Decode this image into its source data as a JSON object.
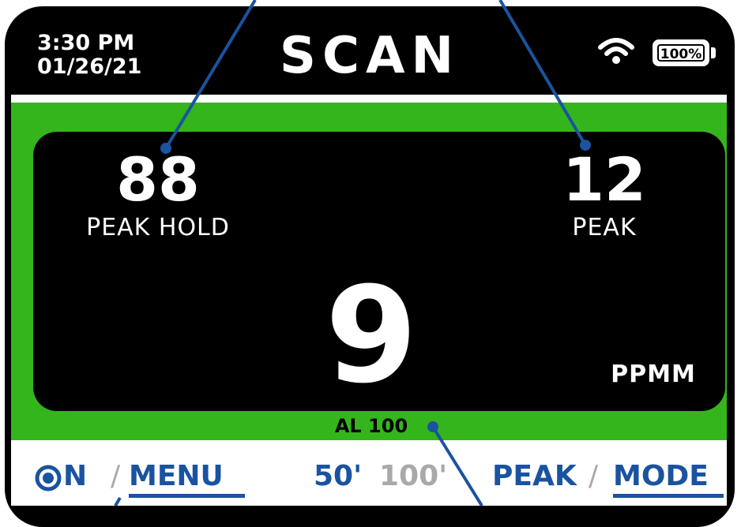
{
  "status": {
    "time": "3:30 PM",
    "date": "01/26/21",
    "battery": "100%"
  },
  "header": {
    "title": "SCAN"
  },
  "readings": {
    "peak_hold_value": "88",
    "peak_hold_label": "PEAK HOLD",
    "peak_value": "12",
    "peak_label": "PEAK",
    "current_value": "9",
    "unit": "PPMM",
    "alarm": "AL 100"
  },
  "footer": {
    "on_label": "N",
    "sep1": "/",
    "menu_label": "MENU",
    "range_active": "50'",
    "range_inactive": "100'",
    "peak_label": "PEAK",
    "sep2": "/",
    "mode_label": "MODE"
  },
  "colors": {
    "accent": "#1a53a0",
    "screen_border": "#35b51c",
    "inactive": "#a9a9a9"
  },
  "icons": {
    "wifi": "wifi-icon",
    "battery": "battery-icon",
    "power": "power-icon"
  }
}
